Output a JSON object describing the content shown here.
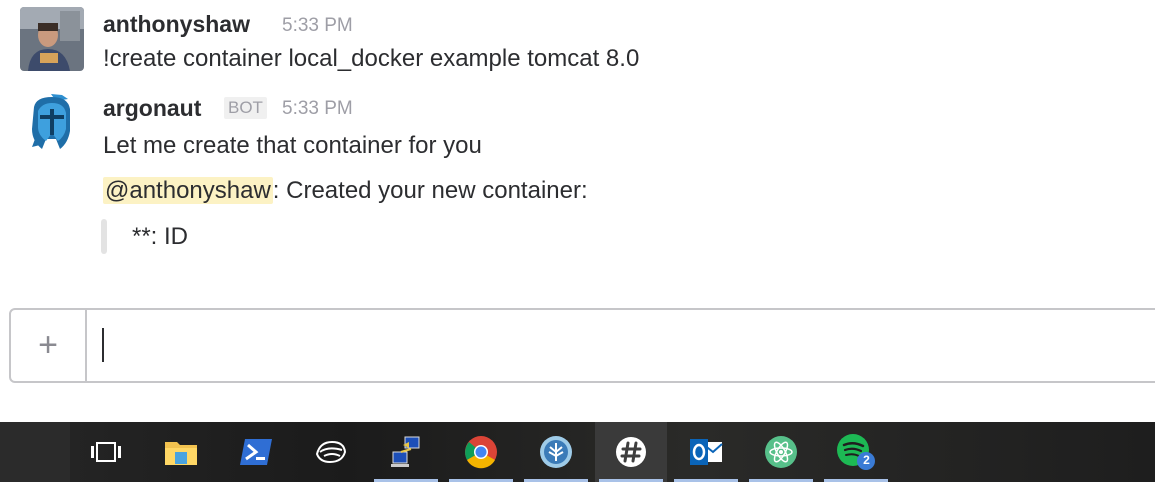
{
  "messages": [
    {
      "user": "anthonyshaw",
      "time": "5:33 PM",
      "text": "!create container local_docker example tomcat 8.0"
    },
    {
      "user": "argonaut",
      "bot_label": "BOT",
      "time": "5:33 PM",
      "text": "Let me create that container for you",
      "mention": "@anthonyshaw",
      "mention_text": ": Created your new container:",
      "attachment": "**: ID"
    }
  ],
  "composer": {
    "plus_label": "+",
    "value": ""
  },
  "taskbar": {
    "items": [
      {
        "icon": "task-view-icon"
      },
      {
        "icon": "file-explorer-icon"
      },
      {
        "icon": "powershell-icon"
      },
      {
        "icon": "mouse-app-icon"
      },
      {
        "icon": "network-app-icon"
      },
      {
        "icon": "chrome-icon"
      },
      {
        "icon": "app-tree-icon"
      },
      {
        "icon": "slack-icon"
      },
      {
        "icon": "outlook-icon"
      },
      {
        "icon": "atom-icon"
      },
      {
        "icon": "spotify-icon",
        "badge": "2"
      }
    ]
  },
  "colors": {
    "mention_bg": "#fcf2c4",
    "time": "#9e9ea6",
    "taskbar_bg": "#1f1f1f",
    "taskbar_underline": "#a9c2e8"
  }
}
